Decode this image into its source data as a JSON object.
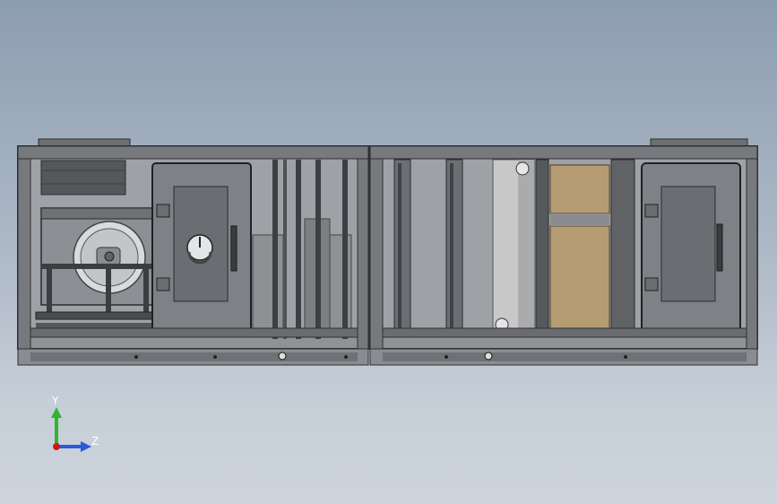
{
  "viewport": {
    "background_top": "#8d9db0",
    "background_bottom": "#cdd4dc"
  },
  "model": {
    "frame_color": "#5a5c5f",
    "panel_color": "#8a8c8f",
    "filter_media_color": "#b59c72",
    "coil_color": "#c8c8c8"
  },
  "triad": {
    "y_label": "Y",
    "z_label": "Z",
    "y_color": "#2fb52f",
    "z_color": "#2a5ad8",
    "x_color": "#d01818"
  }
}
